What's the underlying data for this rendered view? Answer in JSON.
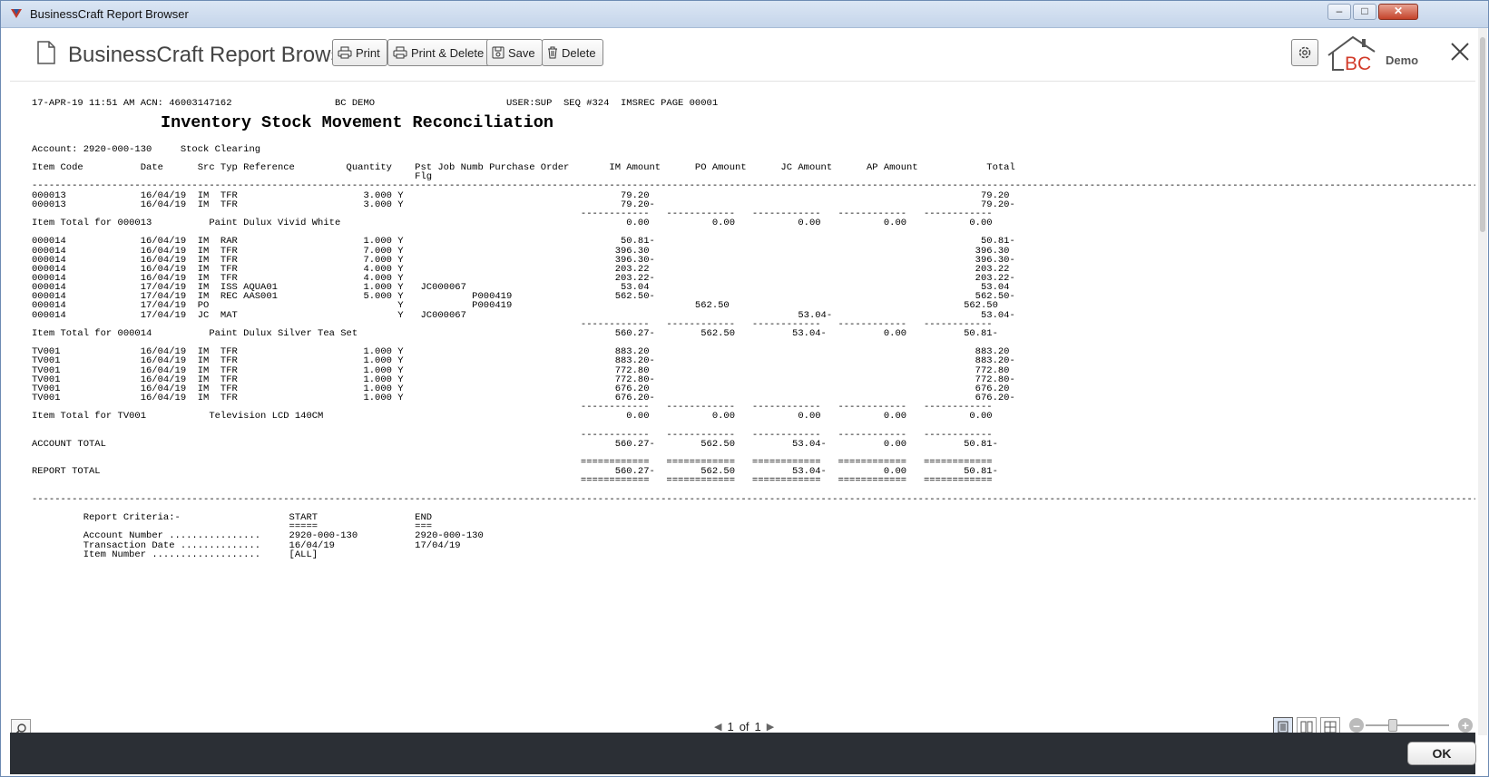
{
  "window": {
    "title": "BusinessCraft Report Browser",
    "min_glyph": "–",
    "max_glyph": "□",
    "close_glyph": "✕"
  },
  "header": {
    "app_title": "BusinessCraft Report Browser",
    "buttons": {
      "print": "Print",
      "print_delete": "Print & Delete",
      "save": "Save",
      "delete": "Delete"
    },
    "logo_text": "BC",
    "demo_label": "Demo"
  },
  "report": {
    "title": "Inventory Stock Movement Reconciliation",
    "body_text": "17-APR-19 11:51 AM ACN: 46003147162                  BC DEMO                       USER:SUP  SEQ #324  IMSREC PAGE 00001\n\n\n\n\nAccount: 2920-000-130     Stock Clearing\n\nItem Code          Date      Src Typ Reference         Quantity    Pst Job Numb Purchase Order       IM Amount      PO Amount      JC Amount      AP Amount            Total\n                                                                   Flg\n----------------------------------------------------------------------------------------------------------------------------------------------------------------------------------------------------------------------------------------------------------------------\n000013             16/04/19  IM  TFR                      3.000 Y                                      79.20                                                          79.20\n000013             16/04/19  IM  TFR                      3.000 Y                                      79.20-                                                         79.20-\n                                                                                                ------------   ------------   ------------   ------------   ------------\nItem Total for 000013          Paint Dulux Vivid White                                                  0.00           0.00           0.00           0.00           0.00\n\n000014             16/04/19  IM  RAR                      1.000 Y                                      50.81-                                                         50.81-\n000014             16/04/19  IM  TFR                      7.000 Y                                     396.30                                                         396.30\n000014             16/04/19  IM  TFR                      7.000 Y                                     396.30-                                                        396.30-\n000014             16/04/19  IM  TFR                      4.000 Y                                     203.22                                                         203.22\n000014             16/04/19  IM  TFR                      4.000 Y                                     203.22-                                                        203.22-\n000014             17/04/19  IM  ISS AQUA01               1.000 Y   JC000067                           53.04                                                          53.04\n000014             17/04/19  IM  REC AAS001               5.000 Y            P000419                  562.50-                                                        562.50-\n000014             17/04/19  PO                                 Y            P000419                                562.50                                         562.50\n000014             17/04/19  JC  MAT                            Y   JC000067                                                          53.04-                          53.04-\n                                                                                                ------------   ------------   ------------   ------------   ------------\nItem Total for 000014          Paint Dulux Silver Tea Set                                             560.27-        562.50          53.04-          0.00          50.81-\n\nTV001              16/04/19  IM  TFR                      1.000 Y                                     883.20                                                         883.20\nTV001              16/04/19  IM  TFR                      1.000 Y                                     883.20-                                                        883.20-\nTV001              16/04/19  IM  TFR                      1.000 Y                                     772.80                                                         772.80\nTV001              16/04/19  IM  TFR                      1.000 Y                                     772.80-                                                        772.80-\nTV001              16/04/19  IM  TFR                      1.000 Y                                     676.20                                                         676.20\nTV001              16/04/19  IM  TFR                      1.000 Y                                     676.20-                                                        676.20-\n                                                                                                ------------   ------------   ------------   ------------   ------------\nItem Total for TV001           Television LCD 140CM                                                     0.00           0.00           0.00           0.00           0.00\n\n                                                                                                ------------   ------------   ------------   ------------   ------------\nACCOUNT TOTAL                                                                                         560.27-        562.50          53.04-          0.00          50.81-\n\n                                                                                                ============   ============   ============   ============   ============\nREPORT TOTAL                                                                                          560.27-        562.50          53.04-          0.00          50.81-\n                                                                                                ============   ============   ============   ============   ============\n\n----------------------------------------------------------------------------------------------------------------------------------------------------------------------------------------------------------------------------------------------------------------------\n\n         Report Criteria:-                   START                 END\n                                             =====                 ===\n         Account Number ................     2920-000-130          2920-000-130\n         Transaction Date ..............     16/04/19              17/04/19\n         Item Number ...................     [ALL]"
  },
  "statusbar": {
    "page_current": "1",
    "page_of": "of",
    "page_total": "1",
    "zoom_percent": 30
  },
  "footer": {
    "ok_label": "OK"
  }
}
